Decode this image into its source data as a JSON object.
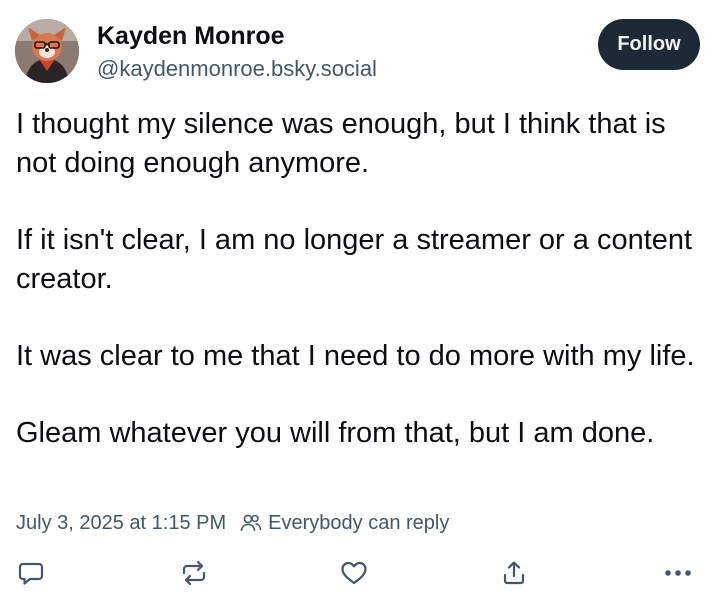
{
  "author": {
    "display_name": "Kayden Monroe",
    "handle": "@kaydenmonroe.bsky.social"
  },
  "follow_label": "Follow",
  "post": {
    "paragraphs": [
      "I thought my silence was enough, but I think that is not doing enough anymore.",
      "If it isn't clear, I am no longer a streamer or a content creator.",
      "It was clear to me that I need to do more with my life.",
      "Gleam whatever you will from that, but I am done."
    ]
  },
  "meta": {
    "timestamp": "July 3, 2025 at 1:15 PM",
    "reply_setting": "Everybody can reply"
  },
  "actions": {
    "icons": [
      "comment-icon",
      "repost-icon",
      "like-icon",
      "share-icon",
      "more-icon"
    ]
  },
  "colors": {
    "text": "#0b0f14",
    "secondary_text": "#42576c",
    "follow_button_bg": "#1e2936",
    "follow_button_text": "#f1f3f5"
  }
}
